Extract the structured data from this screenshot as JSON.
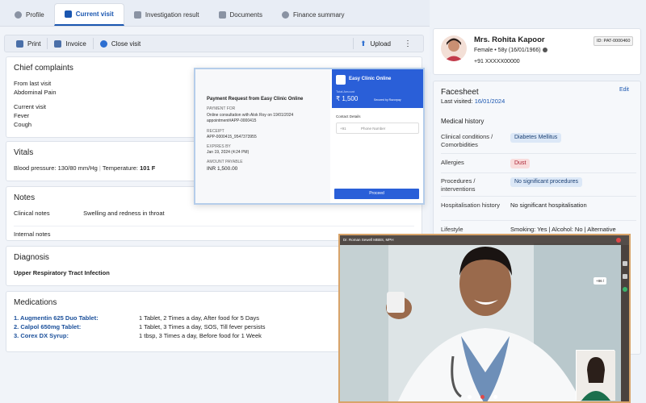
{
  "tabs": [
    {
      "label": "Profile",
      "icon": "person-icon"
    },
    {
      "label": "Current visit",
      "icon": "visit-icon"
    },
    {
      "label": "Investigation result",
      "icon": "document-icon"
    },
    {
      "label": "Documents",
      "icon": "folder-icon"
    },
    {
      "label": "Finance summary",
      "icon": "finance-icon"
    }
  ],
  "toolbar": {
    "print": "Print",
    "invoice": "Invoice",
    "close_visit": "Close visit",
    "upload": "Upload"
  },
  "chief": {
    "title": "Chief complaints",
    "from_last_visit": "From last visit",
    "last_complaint": "Abdominal Pain",
    "current_visit": "Current visit",
    "current_1": "Fever",
    "current_2": "Cough"
  },
  "vitals": {
    "title": "Vitals",
    "bp_label": "Blood pressure:",
    "bp_value": "130/80 mm/Hg",
    "temp_label": "Temperature:",
    "temp_value": "101 F"
  },
  "notes": {
    "title": "Notes",
    "clinical_label": "Clinical notes",
    "clinical_value": "Swelling and redness in throat",
    "internal_label": "Internal notes"
  },
  "diagnosis": {
    "title": "Diagnosis",
    "value": "Upper Respiratory Tract Infection"
  },
  "medications": {
    "title": "Medications",
    "items": [
      {
        "name": "1. Augmentin 625 Duo Tablet:",
        "dose": "1 Tablet, 2 Times a day, After food for 5 Days"
      },
      {
        "name": "2. Calpol 650mg Tablet:",
        "dose": "1 Tablet, 3 Times a day, SOS, Till fever persists"
      },
      {
        "name": "3. Corex DX Syrup:",
        "dose": "1 tbsp, 3 Times a day, Before food for 1 Week"
      }
    ]
  },
  "patient": {
    "name": "Mrs. Rohita Kapoor",
    "id": "ID: PAT-0000460",
    "details": "Female • 58y (16/01/1966)",
    "phone": "+91 XXXXX00000"
  },
  "facesheet": {
    "title": "Facesheet",
    "edit": "Edit",
    "last_visited_label": "Last visited:",
    "last_visited": "16/01/2024",
    "section": "Medical history",
    "rows": [
      {
        "label": "Clinical conditions / Comorbidities",
        "value": "Diabetes Mellitus"
      },
      {
        "label": "Allergies",
        "value": "Dust"
      },
      {
        "label": "Procedures / interventions",
        "value": "No significant procedures"
      },
      {
        "label": "Hospitalisation history",
        "value": "No significant hospitalisation"
      },
      {
        "label": "Lifestyle",
        "value": "Smoking: Yes | Alcohol: No | Alternative medicine: Yes, Other medicines: Ayurveda"
      }
    ]
  },
  "payment": {
    "title": "Payment Request from Easy Clinic Online",
    "payment_for_label": "PAYMENT FOR",
    "payment_for": "Online consultation with Alok Roy on 19/01/2024 appointment#APP-0000415",
    "receipt_label": "RECEIPT",
    "receipt": "APP-0000415_9547373955",
    "expiry_label": "EXPIRES BY",
    "expiry": "Jan 19, 2024 (4:24 PM)",
    "amount_label": "AMOUNT PAYABLE",
    "amount": "INR 1,500.00",
    "merchant": "Easy Clinic Online",
    "total_label": "Total Amount",
    "total": "₹ 1,500",
    "secured": "Secured by Razorpay",
    "contact": "Contact Details",
    "country_code": "+91",
    "phone_placeholder": "Phone Number",
    "proceed": "Proceed"
  },
  "video": {
    "caller": "Dr. Roman Sewell MBBS, MPH",
    "fullscreen_hint": "+86 /"
  }
}
